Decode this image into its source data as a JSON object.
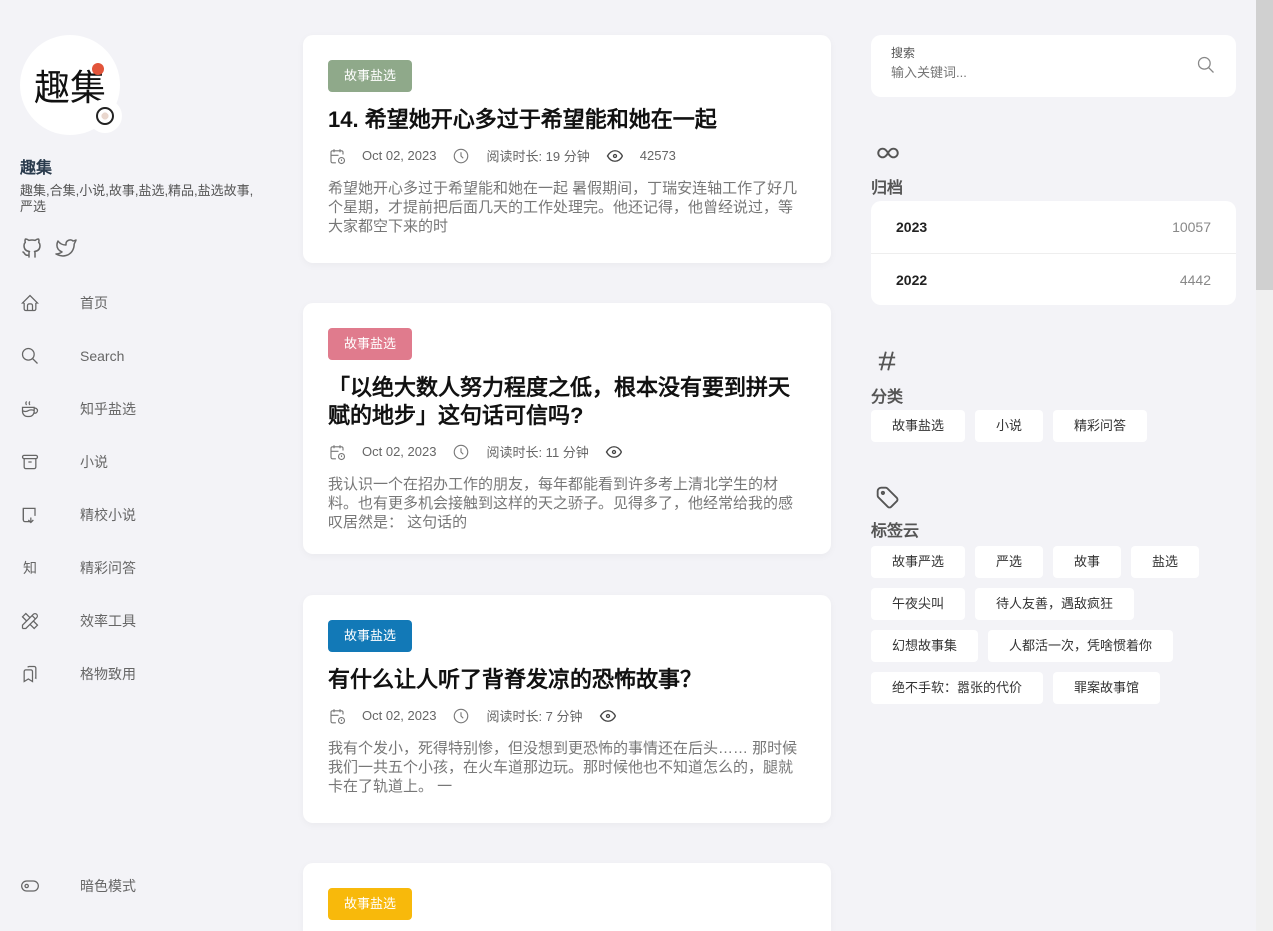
{
  "site": {
    "avatar_text": "趣集",
    "title": "趣集",
    "subtitle": "趣集,合集,小说,故事,盐选,精品,盐选故事,严选"
  },
  "nav": [
    {
      "label": "首页",
      "icon": "home-icon"
    },
    {
      "label": "Search",
      "icon": "search-icon"
    },
    {
      "label": "知乎盐选",
      "icon": "coffee-icon"
    },
    {
      "label": "小说",
      "icon": "archive-box-icon"
    },
    {
      "label": "精校小说",
      "icon": "book-download-icon"
    },
    {
      "label": "精彩问答",
      "icon": "zhi-icon"
    },
    {
      "label": "效率工具",
      "icon": "tools-icon"
    },
    {
      "label": "格物致用",
      "icon": "bookmark-icon"
    }
  ],
  "dark_mode_label": "暗色模式",
  "posts": [
    {
      "category": "故事盐选",
      "category_color": "#8fa98a",
      "title": "14. 希望她开心多过于希望能和她在一起",
      "date": "Oct 02, 2023",
      "read_time": "阅读时长: 19 分钟",
      "views": "42573",
      "excerpt": "希望她开心多过于希望能和她在一起 暑假期间，丁瑞安连轴工作了好几个星期，才提前把后面几天的工作处理完。他还记得，他曾经说过，等大家都空下来的时"
    },
    {
      "category": "故事盐选",
      "category_color": "#e07b8d",
      "title": "「以绝大数人努力程度之低，根本没有要到拼天赋的地步」这句话可信吗?",
      "date": "Oct 02, 2023",
      "read_time": "阅读时长: 11 分钟",
      "views": "",
      "excerpt": "我认识一个在招办工作的朋友，每年都能看到许多考上清北学生的材料。也有更多机会接触到这样的天之骄子。见得多了，他经常给我的感叹居然是： 这句话的"
    },
    {
      "category": "故事盐选",
      "category_color": "#1279b7",
      "title": "有什么让人听了背脊发凉的恐怖故事？",
      "date": "Oct 02, 2023",
      "read_time": "阅读时长: 7 分钟",
      "views": "",
      "excerpt": "我有个发小，死得特别惨，但没想到更恐怖的事情还在后头…… 那时候我们一共五个小孩，在火车道那边玩。那时候他也不知道怎么的，腿就卡在了轨道上。 一"
    },
    {
      "category": "故事盐选",
      "category_color": "#f8b90b"
    }
  ],
  "search": {
    "label": "搜索",
    "placeholder": "输入关键词..."
  },
  "archive": {
    "title": "归档",
    "rows": [
      {
        "year": "2023",
        "count": "10057"
      },
      {
        "year": "2022",
        "count": "4442"
      }
    ]
  },
  "categories": {
    "title": "分类",
    "items": [
      "故事盐选",
      "小说",
      "精彩问答"
    ]
  },
  "tags": {
    "title": "标签云",
    "items": [
      "故事严选",
      "严选",
      "故事",
      "盐选",
      "午夜尖叫",
      "待人友善，遇敌疯狂",
      "幻想故事集",
      "人都活一次，凭啥惯着你",
      "绝不手软：嚣张的代价",
      "罪案故事馆"
    ]
  }
}
